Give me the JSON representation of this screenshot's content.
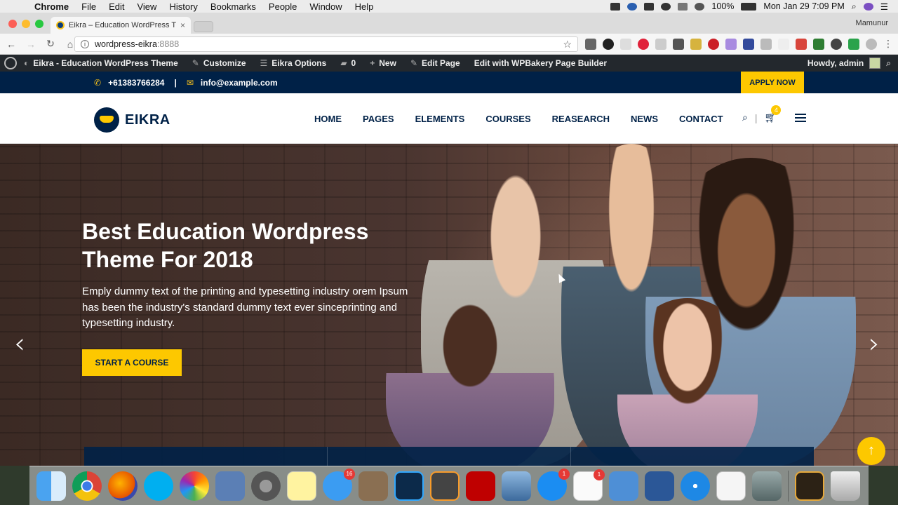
{
  "menubar": {
    "apple": "",
    "items": [
      "Chrome",
      "File",
      "Edit",
      "View",
      "History",
      "Bookmarks",
      "People",
      "Window",
      "Help"
    ],
    "battery": "100%",
    "datetime": "Mon Jan 29  7:09 PM"
  },
  "browser": {
    "tab_title": "Eikra – Education WordPress T",
    "tab_close": "×",
    "profile": "Mamunur",
    "url_host": "wordpress-eikra",
    "url_port": ":8888"
  },
  "adminbar": {
    "site": "Eikra - Education WordPress Theme",
    "customize": "Customize",
    "options": "Eikra Options",
    "comments": "0",
    "new": "New",
    "edit_page": "Edit Page",
    "wpbakery": "Edit with WPBakery Page Builder",
    "howdy": "Howdy, admin"
  },
  "topbar": {
    "phone": "+61383766284",
    "divider": "|",
    "email": "info@example.com",
    "apply": "APPLY NOW"
  },
  "header": {
    "logo": "EIKRA",
    "nav": [
      "HOME",
      "PAGES",
      "ELEMENTS",
      "COURSES",
      "REASEARCH",
      "NEWS",
      "CONTACT"
    ],
    "cart_count": "4"
  },
  "hero": {
    "title": "Best Education Wordpress Theme For 2018",
    "text": "Emply dummy text of the printing and typesetting industry orem Ipsum has been the industry's standard dummy text ever sinceprinting and typesetting industry.",
    "button": "START A COURSE"
  },
  "dock": {
    "badges": {
      "messages": "16",
      "appstore": "1",
      "reminders": "1"
    }
  }
}
